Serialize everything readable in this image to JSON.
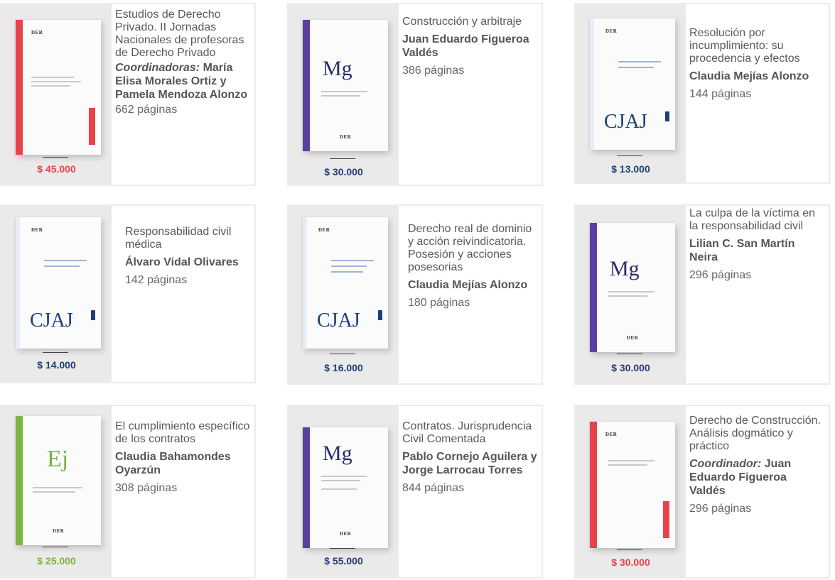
{
  "books": [
    {
      "title": "Estudios de Derecho Privado. II Jornadas Nacionales de profesoras de Derecho Privado",
      "author_role": "Coordinadoras:",
      "author": "María Elisa Morales Ortiz y Pamela Mendoza Alonzo",
      "pages": "662 páginas",
      "price": "$ 45.000",
      "price_color": "#e8424b",
      "cover_series": "",
      "cover_publisher": "DER",
      "cover_color": "#e8424b"
    },
    {
      "title": "Construcción y arbitraje",
      "author_role": "",
      "author": "Juan Eduardo Figueroa Valdés",
      "pages": "386 páginas",
      "price": "$ 30.000",
      "price_color": "#2b3a78",
      "cover_series": "Mg",
      "cover_publisher": "DER",
      "cover_color": "#5b3f9e"
    },
    {
      "title": "Resolución por incumplimiento: su procedencia y efectos",
      "author_role": "",
      "author": "Claudia Mejías Alonzo",
      "pages": "144 páginas",
      "price": "$ 13.000",
      "price_color": "#1d3e7a",
      "cover_series": "CJAJ",
      "cover_publisher": "DER",
      "cover_color": "#1d3e7a"
    },
    {
      "title": "Responsabilidad civil médica",
      "author_role": "",
      "author": "Álvaro Vidal Olivares",
      "pages": "142 páginas",
      "price": "$ 14.000",
      "price_color": "#1d3e7a",
      "cover_series": "CJAJ",
      "cover_publisher": "DER",
      "cover_color": "#1d3e7a"
    },
    {
      "title": "Derecho real de dominio y acción reivindicatoria. Posesión y acciones posesorias",
      "author_role": "",
      "author": "Claudia Mejías Alonzo",
      "pages": "180 páginas",
      "price": "$ 16.000",
      "price_color": "#1d3e7a",
      "cover_series": "CJAJ",
      "cover_publisher": "DER",
      "cover_color": "#1d3e7a"
    },
    {
      "title": "La culpa de la víctima en la responsabilidad civil",
      "author_role": "",
      "author": "Lilian C. San Martín Neira",
      "pages": "296 páginas",
      "price": "$ 30.000",
      "price_color": "#2b3a78",
      "cover_series": "Mg",
      "cover_publisher": "DER",
      "cover_color": "#5b3f9e"
    },
    {
      "title": "El cumplimiento específico de los contratos",
      "author_role": "",
      "author": "Claudia Bahamondes Oyarzún",
      "pages": "308 páginas",
      "price": "$ 25.000",
      "price_color": "#7cb342",
      "cover_series": "Ej",
      "cover_publisher": "DER",
      "cover_color": "#7cb342"
    },
    {
      "title": "Contratos. Jurisprudencia Civil Comentada",
      "author_role": "",
      "author": "Pablo Cornejo Aguilera y Jorge Larrocau Torres",
      "pages": "844 páginas",
      "price": "$ 55.000",
      "price_color": "#2b3a78",
      "cover_series": "Mg",
      "cover_publisher": "DER",
      "cover_color": "#5b3f9e"
    },
    {
      "title": "Derecho de Construcción. Análisis dogmático y práctico",
      "author_role": "Coordinador:",
      "author": "Juan Eduardo Figueroa Valdés",
      "pages": "296 páginas",
      "price": "$ 30.000",
      "price_color": "#e8424b",
      "cover_series": "",
      "cover_publisher": "DER",
      "cover_color": "#e8424b"
    }
  ]
}
